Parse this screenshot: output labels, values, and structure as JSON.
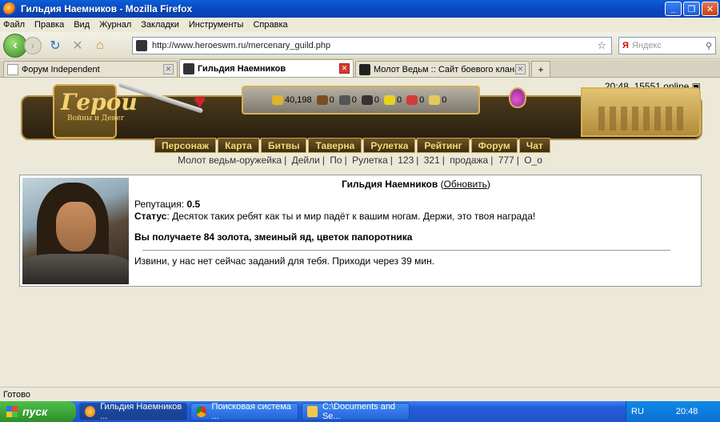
{
  "window": {
    "title": "Гильдия Наемников - Mozilla Firefox"
  },
  "menu": [
    "Файл",
    "Правка",
    "Вид",
    "Журнал",
    "Закладки",
    "Инструменты",
    "Справка"
  ],
  "navbar": {
    "url": "http://www.heroeswm.ru/mercenary_guild.php",
    "search_placeholder": "Яндекс",
    "search_engine_label": "Я"
  },
  "tabs": [
    {
      "title": "Форум Independent",
      "active": false
    },
    {
      "title": "Гильдия Наемников",
      "active": true
    },
    {
      "title": "Молот Ведьм :: Сайт боевого клана ...",
      "active": false
    }
  ],
  "page": {
    "time_online": "20:48, 15551 online",
    "logo_text": "Герои",
    "logo_sub": "Войны и Денег",
    "resources": [
      "40,198",
      "0",
      "0",
      "0",
      "0",
      "0",
      "0"
    ],
    "menu_items": [
      "Персонаж",
      "Карта",
      "Битвы",
      "Таверна",
      "Рулетка",
      "Рейтинг",
      "Форум",
      "Чат"
    ],
    "quick_links": [
      "Молот ведьм-оружейка",
      "Дейли",
      "По",
      "Рулетка",
      "123",
      "321",
      "продажа",
      "777",
      "O_o"
    ],
    "guild": {
      "title": "Гильдия Наемников",
      "refresh_label": "Обновить",
      "reputation_label": "Репутация:",
      "reputation_value": "0.5",
      "status_label": "Статус",
      "status_text": ": Десяток таких ребят как ты и мир падёт к вашим ногам. Держи, это твоя награда!",
      "reward_text": "Вы получаете 84 золота, змеиный яд, цветок папоротника",
      "no_task_text": "Извини, у нас нет сейчас заданий для тебя. Приходи через 39 мин."
    }
  },
  "status_bar": {
    "text": "Готово"
  },
  "taskbar": {
    "start_label": "пуск",
    "tasks": [
      "Гильдия Наемников ...",
      "Поисковая система ...",
      "C:\\Documents and Se..."
    ],
    "lang": "RU",
    "clock": "20:48"
  },
  "colors": {
    "titlebar": "#0b4cc4",
    "menu_gold": "#f6d872",
    "heart": "#d61f2c"
  }
}
